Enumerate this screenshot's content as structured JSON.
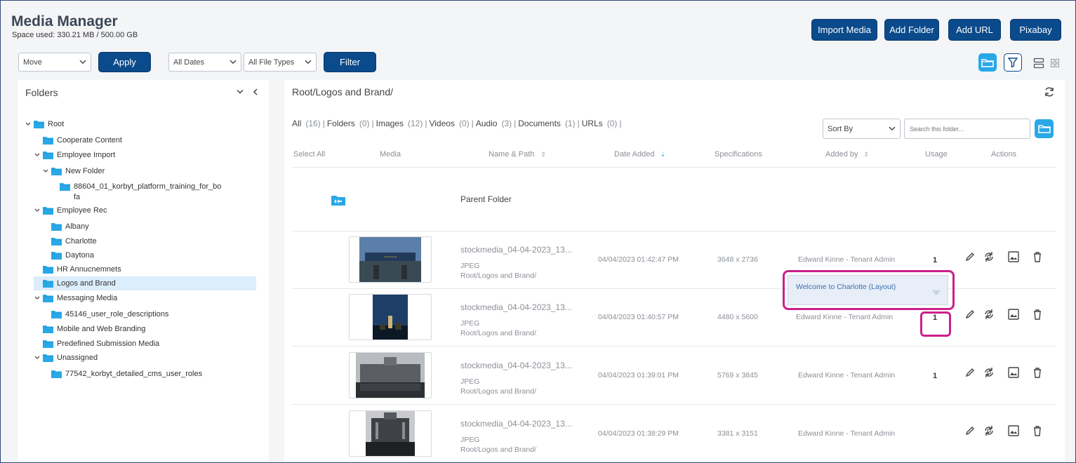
{
  "header": {
    "title": "Media Manager",
    "space_used": "Space used: 330.21 MB / 500.00 GB",
    "buttons": {
      "import": "Import Media",
      "add_folder": "Add Folder",
      "add_url": "Add URL",
      "pixabay": "Pixabay"
    }
  },
  "toolbar": {
    "bulk_action": "Move",
    "apply": "Apply",
    "dates": "All Dates",
    "file_types": "All File Types",
    "filter": "Filter"
  },
  "folders": {
    "title": "Folders",
    "tree": [
      {
        "label": "Root",
        "depth": 0,
        "toggle": true
      },
      {
        "label": "Cooperate Content",
        "depth": 1,
        "toggle": false
      },
      {
        "label": "Employee Import",
        "depth": 1,
        "toggle": true
      },
      {
        "label": "New Folder",
        "depth": 2,
        "toggle": true
      },
      {
        "label": "88604_01_korbyt_platform_training_for_bo",
        "label2": "fa",
        "depth": 3,
        "toggle": false
      },
      {
        "label": "Employee Rec",
        "depth": 1,
        "toggle": true
      },
      {
        "label": "Albany",
        "depth": 2,
        "toggle": false
      },
      {
        "label": "Charlotte",
        "depth": 2,
        "toggle": false
      },
      {
        "label": "Daytona",
        "depth": 2,
        "toggle": false
      },
      {
        "label": "HR Annucnemnets",
        "depth": 1,
        "toggle": false
      },
      {
        "label": "Logos and Brand",
        "depth": 1,
        "toggle": false,
        "selected": true
      },
      {
        "label": "Messaging Media",
        "depth": 1,
        "toggle": true
      },
      {
        "label": "45146_user_role_descriptions",
        "depth": 2,
        "toggle": false
      },
      {
        "label": "Mobile and Web Branding",
        "depth": 1,
        "toggle": false
      },
      {
        "label": "Predefined Submission Media",
        "depth": 1,
        "toggle": false
      },
      {
        "label": "Unassigned",
        "depth": 1,
        "toggle": true
      },
      {
        "label": "77542_korbyt_detailed_cms_user_roles",
        "depth": 2,
        "toggle": false
      }
    ]
  },
  "main": {
    "path": "Root/Logos and Brand/",
    "tabs": [
      {
        "label": "All",
        "count": "(16)"
      },
      {
        "label": "Folders",
        "count": "(0)"
      },
      {
        "label": "Images",
        "count": "(12)"
      },
      {
        "label": "Videos",
        "count": "(0)"
      },
      {
        "label": "Audio",
        "count": "(3)"
      },
      {
        "label": "Documents",
        "count": "(1)"
      },
      {
        "label": "URLs",
        "count": "(0)"
      }
    ],
    "sort_by": "Sort By",
    "search_placeholder": "Search this folder...",
    "columns": {
      "select_all": "Select All",
      "media": "Media",
      "name_path": "Name & Path",
      "date_added": "Date Added",
      "specifications": "Specifications",
      "added_by": "Added by",
      "usage": "Usage",
      "actions": "Actions"
    },
    "parent_folder": "Parent Folder",
    "rows": [
      {
        "name": "stockmedia_04-04-2023_13...",
        "type": "JPEG",
        "path": "Root/Logos and Brand/",
        "date": "04/04/2023 01:42:47 PM",
        "spec": "3648 x 2736",
        "added_by": "Edward Kinne - Tenant Admin",
        "usage": "1",
        "thumb": "beach"
      },
      {
        "name": "stockmedia_04-04-2023_13...",
        "type": "JPEG",
        "path": "Root/Logos and Brand/",
        "date": "04/04/2023 01:40:57 PM",
        "spec": "4480 x 5600",
        "added_by": "Edward Kinne - Tenant Admin",
        "usage": "1",
        "thumb": "night"
      },
      {
        "name": "stockmedia_04-04-2023_13...",
        "type": "JPEG",
        "path": "Root/Logos and Brand/",
        "date": "04/04/2023 01:39:01 PM",
        "spec": "5769 x 3845",
        "added_by": "Edward Kinne - Tenant Admin",
        "usage": "1",
        "thumb": "capitol"
      },
      {
        "name": "stockmedia_04-04-2023_13...",
        "type": "JPEG",
        "path": "Root/Logos and Brand/",
        "date": "04/04/2023 01:38:29 PM",
        "spec": "3381 x 3151",
        "added_by": "Edward Kinne - Tenant Admin",
        "usage": "",
        "thumb": "building"
      }
    ],
    "usage_popup": "Welcome to Charlotte (Layout)"
  },
  "colors": {
    "primary": "#0b4a8b",
    "folder": "#29a8e8",
    "highlight": "#cc1f8a",
    "selected_row": "#dcedfb"
  }
}
